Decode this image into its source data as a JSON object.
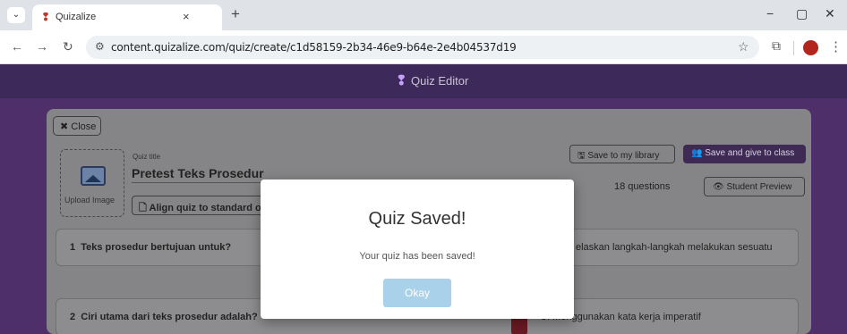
{
  "browser": {
    "tab_title": "Quizalize",
    "tab_close": "×",
    "new_tab": "+",
    "url": "content.quizalize.com/quiz/create/c1d58159-2b34-46e9-b64e-2e4b04537d19",
    "icons": [
      "tab-search-icon",
      "quizalize-favicon-icon",
      "back-icon",
      "forward-icon",
      "reload-icon",
      "site-info-icon",
      "bookmark-star-icon",
      "extensions-icon",
      "profile-icon",
      "more-menu-icon",
      "minimize-icon",
      "restore-icon",
      "close-window-icon"
    ]
  },
  "app": {
    "title": "Quiz Editor",
    "close_label": "Close",
    "upload_label": "Upload Image",
    "quiz_title_label": "Quiz title",
    "quiz_title": "Pretest Teks Prosedur",
    "align_label": "Align quiz to standard or",
    "save_library": "Save to my library",
    "save_class": "Save and give to class",
    "question_count": "18 questions",
    "student_preview": "Student Preview",
    "accent_color": "#3e2a55"
  },
  "questions": [
    {
      "number": "1",
      "text": "Teks prosedur bertujuan untuk?",
      "answer": "elaskan langkah-langkah melakukan sesuatu"
    },
    {
      "number": "2",
      "text": "Ciri utama dari teks prosedur adalah?",
      "answer": "C. Menggunakan kata kerja imperatif"
    }
  ],
  "modal": {
    "title": "Quiz Saved!",
    "message": "Your quiz has been saved!",
    "button": "Okay",
    "button_color": "#a9d2ea"
  }
}
